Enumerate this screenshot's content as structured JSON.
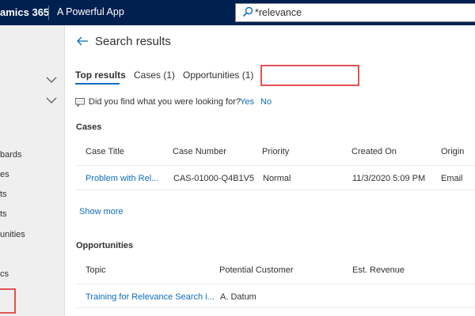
{
  "header": {
    "app_title": "amics 365",
    "app_subtitle": "A Powerful App",
    "search_value": "*relevance"
  },
  "sidebar": {
    "items": [
      {
        "label": "bards"
      },
      {
        "label": "es"
      },
      {
        "label": "ts"
      },
      {
        "label": "ts"
      },
      {
        "label": "unities"
      },
      {
        "label": "cs"
      }
    ]
  },
  "main": {
    "title": "Search results",
    "tabs": [
      {
        "label": "Top results",
        "active": true
      },
      {
        "label": "Cases (1)",
        "active": false
      },
      {
        "label": "Opportunities (1)",
        "active": false
      }
    ],
    "feedback": {
      "question": "Did you find what you were looking for?",
      "yes": "Yes",
      "no": "No"
    },
    "cases": {
      "label": "Cases",
      "columns": [
        "Case Title",
        "Case Number",
        "Priority",
        "Created On",
        "Origin"
      ],
      "rows": [
        [
          "Problem with Rel...",
          "CAS-01000-Q4B1V5",
          "Normal",
          "11/3/2020 5:09 PM",
          "Email"
        ]
      ],
      "show_more": "Show more"
    },
    "opportunities": {
      "label": "Opportunities",
      "columns": [
        "Topic",
        "Potential Customer",
        "Est. Revenue"
      ],
      "rows": [
        [
          "Training for Relevance Search i...",
          "A. Datum",
          ""
        ]
      ]
    }
  },
  "colors": {
    "topbar": "#002050",
    "link": "#0f6cbd",
    "highlight": "#e05252"
  }
}
